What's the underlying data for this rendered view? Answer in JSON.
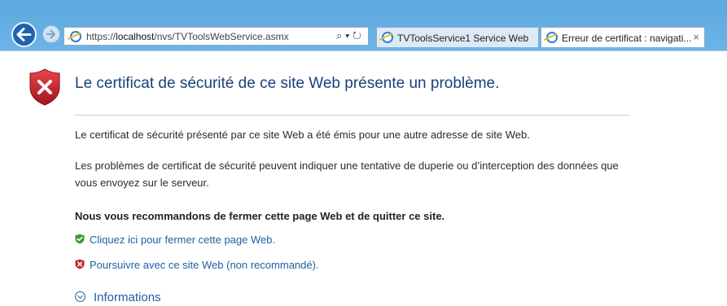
{
  "browser": {
    "address_url_prefix": "https://",
    "address_url_host": "localhost",
    "address_url_path": "/nvs/TVToolsWebService.asmx",
    "address_icons": "⌕ ▾ ↻",
    "tabs": [
      {
        "label": "TVToolsService1 Service Web"
      },
      {
        "label": "Erreur de certificat : navigati...",
        "close": "×"
      }
    ],
    "back_icon": "back-arrow-icon",
    "forward_icon": "forward-arrow-icon"
  },
  "page": {
    "heading": "Le certificat de sécurité de ce site Web présente un problème.",
    "paragraph1": "Le certificat de sécurité présenté par ce site Web a été émis pour une autre adresse de site Web.",
    "paragraph2": "Les problèmes de certificat de sécurité peuvent indiquer une tentative de duperie ou d’interception des données que vous envoyez sur le serveur.",
    "recommendation": "Nous vous recommandons de fermer cette page Web et de quitter ce site.",
    "close_link": "Cliquez ici pour fermer cette page Web.",
    "continue_link": "Poursuivre avec ce site Web (non recommandé).",
    "info_label": "Informations"
  },
  "colors": {
    "chrome_blue": "#6cb4e6",
    "heading_blue": "#17427a",
    "link_blue": "#1f5fa3",
    "shield_red": "#c8232c",
    "shield_green": "#3c9a2f"
  }
}
